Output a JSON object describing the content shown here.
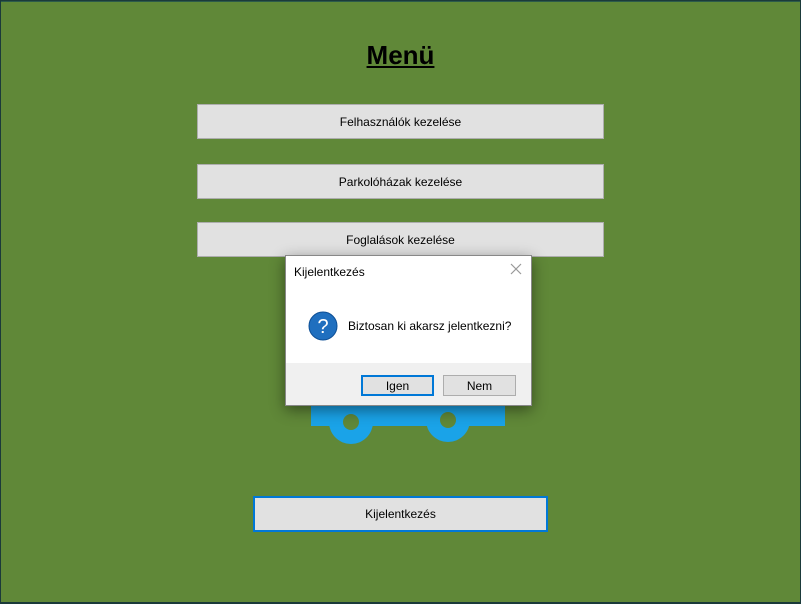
{
  "menu": {
    "title": "Menü",
    "buttons": [
      {
        "label": "Felhasználók kezelése"
      },
      {
        "label": "Parkolóházak kezelése"
      },
      {
        "label": "Foglalások kezelése"
      }
    ],
    "logout_label": "Kijelentkezés"
  },
  "dialog": {
    "title": "Kijelentkezés",
    "message": "Biztosan ki akarsz jelentkezni?",
    "icon": "question-icon",
    "yes_label": "Igen",
    "no_label": "Nem"
  },
  "colors": {
    "background": "#608838",
    "logo": "#1aa3e8",
    "accent": "#0078d7"
  }
}
